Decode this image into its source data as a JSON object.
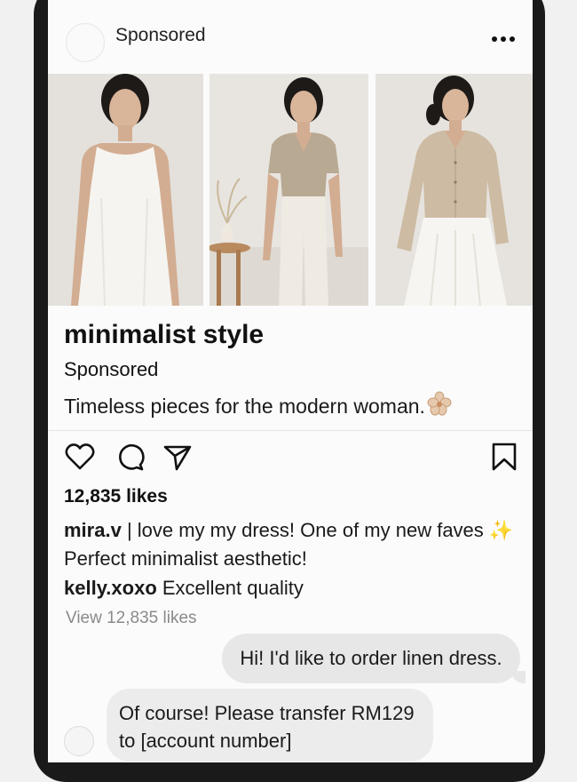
{
  "post": {
    "header_label": "Sponsored",
    "title": "minimalist style",
    "sponsored_label": "Sponsored",
    "tagline": "Timeless pieces for the modern woman."
  },
  "engagement": {
    "likes_text": "12,835 likes",
    "view_all_text": "View 12,835 likes"
  },
  "comments": [
    {
      "user": "mira.v",
      "text": " | love my my dress! One of my new faves ✨ Perfect minimalist aesthetic!"
    },
    {
      "user": "kelly.xoxo",
      "text": " Excellent quality"
    }
  ],
  "messages": {
    "outgoing": "Hi! I'd like to order linen dress.",
    "incoming_line1": "Of course! Please transfer RM129",
    "incoming_line2": "to [account number]"
  },
  "icons": [
    "more-icon",
    "heart-icon",
    "comment-icon",
    "share-icon",
    "bookmark-icon",
    "flower-emoji"
  ]
}
